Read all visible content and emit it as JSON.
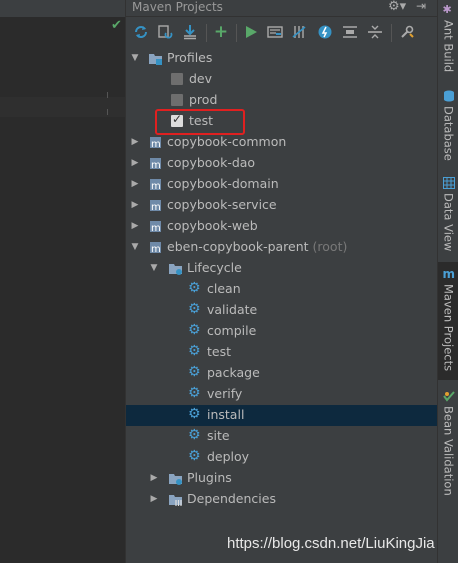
{
  "panel": {
    "title": "Maven Projects"
  },
  "toolbar": {
    "icons": [
      "reimport-icon",
      "generate-sources-icon",
      "download-icon",
      "add-icon",
      "run-icon",
      "execute-goal-icon",
      "toggle-offline-icon",
      "skip-tests-icon",
      "show-dependencies-icon",
      "collapse-all-icon",
      "settings-icon"
    ]
  },
  "tree": {
    "profiles": {
      "label": "Profiles",
      "items": [
        {
          "label": "dev",
          "checked": false
        },
        {
          "label": "prod",
          "checked": false
        },
        {
          "label": "test",
          "checked": true
        }
      ]
    },
    "modules": [
      {
        "label": "copybook-common"
      },
      {
        "label": "copybook-dao"
      },
      {
        "label": "copybook-domain"
      },
      {
        "label": "copybook-service"
      },
      {
        "label": "copybook-web"
      }
    ],
    "parent": {
      "label": "eben-copybook-parent",
      "suffix": "(root)"
    },
    "lifecycle": {
      "label": "Lifecycle",
      "goals": [
        "clean",
        "validate",
        "compile",
        "test",
        "package",
        "verify",
        "install",
        "site",
        "deploy"
      ],
      "selected": "install"
    },
    "plugins": {
      "label": "Plugins"
    },
    "dependencies": {
      "label": "Dependencies"
    }
  },
  "side_tabs": [
    "Ant Build",
    "Database",
    "Data View",
    "Maven Projects",
    "Bean Validation"
  ],
  "active_side_tab": "Maven Projects",
  "watermark": "https://blog.csdn.net/LiuKingJia",
  "colors": {
    "panel_bg": "#3c3f41",
    "selection": "#0d293e",
    "highlight_box": "#e02020",
    "run_green": "#59a869",
    "accent_blue": "#3592c4"
  }
}
